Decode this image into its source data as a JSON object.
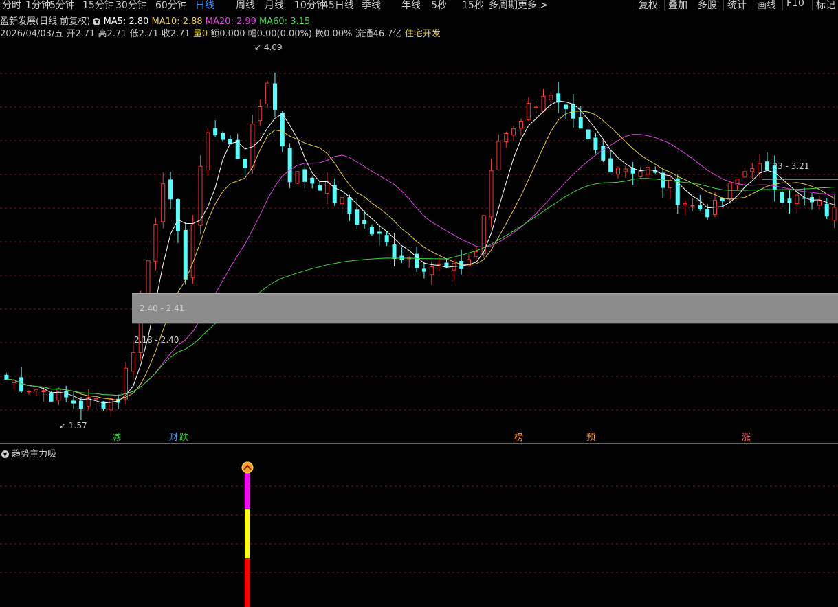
{
  "toolbar": {
    "periods": [
      {
        "label": "分时",
        "active": false
      },
      {
        "label": "1分钟",
        "active": false
      },
      {
        "label": "5分钟",
        "active": false
      },
      {
        "label": "15分钟",
        "active": false
      },
      {
        "label": "30分钟",
        "active": false
      },
      {
        "label": "60分钟",
        "active": false
      },
      {
        "label": "日线",
        "active": true
      },
      {
        "label": "周线",
        "active": false
      },
      {
        "label": "月线",
        "active": false
      },
      {
        "label": "10分钟",
        "active": false
      },
      {
        "label": "45日线",
        "active": false
      },
      {
        "label": "季线",
        "active": false
      },
      {
        "label": "年线",
        "active": false
      },
      {
        "label": "5秒",
        "active": false
      },
      {
        "label": "15秒",
        "active": false
      },
      {
        "label": "多周期",
        "active": false
      },
      {
        "label": "更多 >",
        "active": false
      }
    ],
    "tools": [
      "复权",
      "叠加",
      "多股",
      "统计",
      "画线",
      "F10",
      "标记"
    ]
  },
  "header": {
    "stock_title": "盈新发展(日线 前复权)",
    "ma5_label": "MA5: 2.80",
    "ma10_label": "MA10: 2.88",
    "ma20_label": "MA20: 2.99",
    "ma60_label": "MA60: 3.15"
  },
  "info": {
    "date": "2026/04/03/五",
    "open": "开2.71",
    "high": "高2.71",
    "low": "低2.71",
    "close": "收2.71",
    "volume": "量0",
    "amount": "额0.000",
    "change": "幅0.00(0.00%)",
    "turnover": "换0.00%",
    "float_cap": "流通46.7亿",
    "sector": "住宅开发"
  },
  "sub_panel": {
    "indicator_title": "趋势主力吸",
    "colors": [
      "#ff00ff",
      "#ffff00",
      "#ff0000"
    ]
  },
  "chart_data": {
    "type": "candlestick",
    "price_range": [
      1.4,
      4.2
    ],
    "up_color": "#ff3232",
    "down_color": "#54ffff",
    "ma_colors": {
      "ma5": "#ffffff",
      "ma10": "#e6d03a",
      "ma20": "#e040e0",
      "ma60": "#3cd83c"
    },
    "annotations": [
      {
        "label": "4.09",
        "type": "high"
      },
      {
        "label": "1.57",
        "type": "low"
      },
      {
        "label": "3.23 - 3.21",
        "type": "gap"
      },
      {
        "label": "2.40 - 2.41",
        "type": "zone"
      },
      {
        "label": "2.18 - 2.40",
        "type": "zone"
      }
    ],
    "zone": {
      "low": 2.18,
      "high": 2.4
    },
    "gap_line": 3.22,
    "event_markers": [
      {
        "label": "减",
        "color": "#2ecc40"
      },
      {
        "label": "财",
        "color": "#4aa0ff"
      },
      {
        "label": "跌",
        "color": "#2ecc40"
      },
      {
        "label": "榜",
        "color": "#ff9d4a"
      },
      {
        "label": "预",
        "color": "#ff9d4a"
      },
      {
        "label": "涨",
        "color": "#ff6060"
      }
    ]
  }
}
